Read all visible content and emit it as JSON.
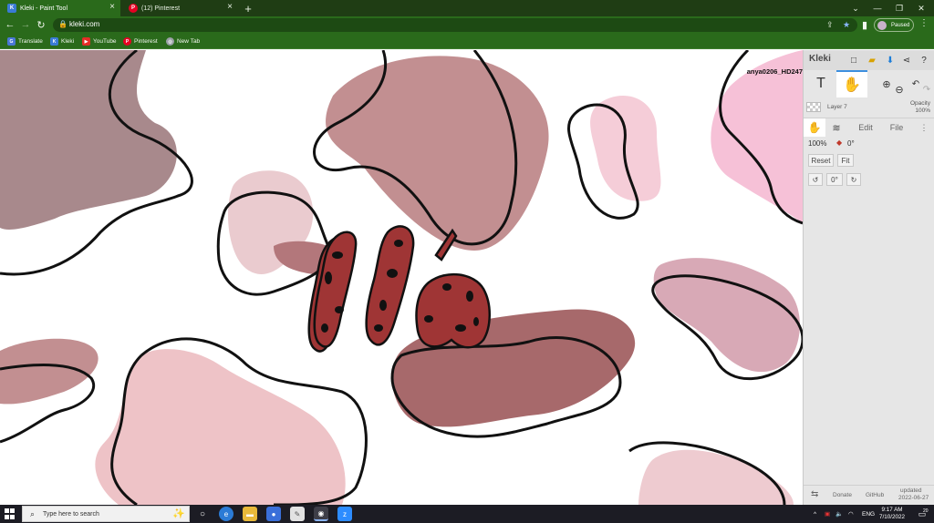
{
  "browser": {
    "tabs": [
      {
        "title": "Kleki - Paint Tool",
        "icon": "kleki-favicon",
        "active": true
      },
      {
        "title": "(12) Pinterest",
        "icon": "pinterest-favicon",
        "active": false
      }
    ],
    "new_tab": "+",
    "window_controls": [
      "⌄",
      "—",
      "❐",
      "✕"
    ],
    "url": "kleki.com",
    "profile_label": "Paused",
    "bookmarks": [
      {
        "label": "Translate",
        "icon": "translate-icon",
        "color": "#4a78d6"
      },
      {
        "label": "Kleki",
        "icon": "kleki-icon",
        "color": "#3a7bd5"
      },
      {
        "label": "YouTube",
        "icon": "youtube-icon",
        "color": "#e52d27"
      },
      {
        "label": "Pinterest",
        "icon": "pinterest-icon",
        "color": "#e60023"
      },
      {
        "label": "New Tab",
        "icon": "globe-icon",
        "color": "#9aa0a6"
      }
    ]
  },
  "canvas": {
    "watermark": "anya0206_HD247",
    "lettering": "llá"
  },
  "kleki": {
    "logo": "Kleki",
    "layer_name": "Layer 7",
    "opacity_label": "Opacity",
    "opacity_value": "100%",
    "tabs": [
      "Edit",
      "File"
    ],
    "zoom": "100%",
    "rotation": "0°",
    "reset_label": "Reset",
    "fit_label": "Fit",
    "rotate_value": "0°",
    "footer": {
      "donate": "Donate",
      "github": "GitHub",
      "updated": "updated",
      "date": "2022-06-27"
    }
  },
  "taskbar": {
    "search_placeholder": "Type here to search",
    "lang": "ENG",
    "time": "9:17 AM",
    "date": "7/10/2022",
    "notification_count": "20"
  },
  "colors": {
    "browser_bar": "#2a6a1b",
    "tab_strip": "#1f3d14",
    "blob_dark_mauve": "#a8898c",
    "blob_rose": "#c28f91",
    "blob_light_pink": "#f5cdd8",
    "blob_wine": "#a7696b",
    "lettering_red": "#9f3535"
  }
}
